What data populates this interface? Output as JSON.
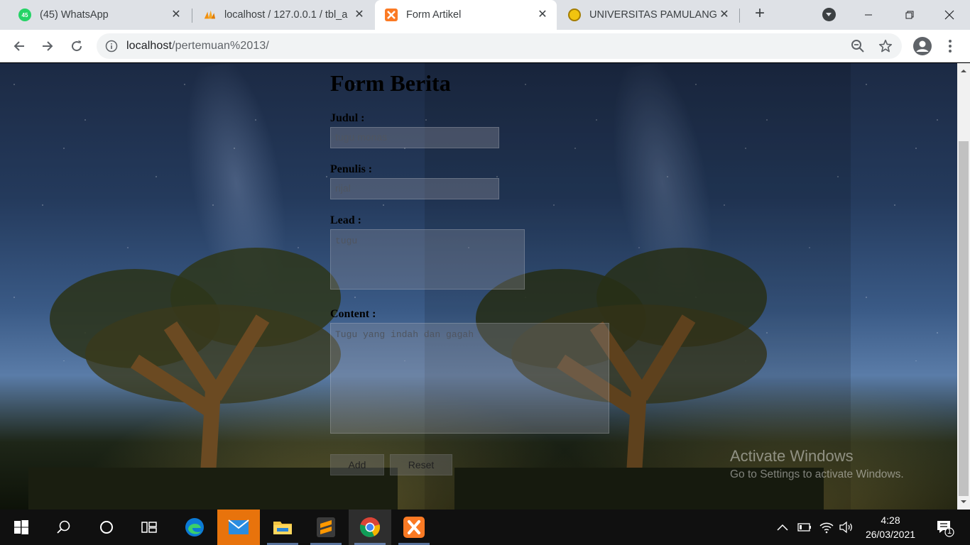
{
  "browser": {
    "tabs": [
      {
        "title": "(45) WhatsApp",
        "badge": "45",
        "icon": "whatsapp-icon",
        "active": false
      },
      {
        "title": "localhost / 127.0.0.1 / tbl_a",
        "icon": "phpmyadmin-icon",
        "active": false
      },
      {
        "title": "Form Artikel",
        "icon": "xampp-icon",
        "active": true
      },
      {
        "title": "UNIVERSITAS PAMULANG",
        "icon": "university-icon",
        "active": false
      }
    ],
    "address": {
      "host": "localhost",
      "path": "/pertemuan%2013/"
    }
  },
  "form": {
    "title": "Form Berita",
    "fields": {
      "judul": {
        "label": "Judul :",
        "value": "tugu monas"
      },
      "penulis": {
        "label": "Penulis :",
        "value": "rijal"
      },
      "lead": {
        "label": "Lead :",
        "value": "tugu"
      },
      "content": {
        "label": "Content :",
        "value": "Tugu yang indah dan gagah"
      }
    },
    "buttons": {
      "add": "Add",
      "reset": "Reset"
    }
  },
  "watermark": {
    "line1": "Activate Windows",
    "line2": "Go to Settings to activate Windows."
  },
  "taskbar": {
    "apps": [
      "start-icon",
      "search-icon",
      "cortana-icon",
      "task-view-icon",
      "edge-icon",
      "mail-icon",
      "file-explorer-icon",
      "sublime-icon",
      "chrome-icon",
      "xampp-icon"
    ],
    "time": "4:28",
    "date": "26/03/2021",
    "notification_count": "1"
  }
}
